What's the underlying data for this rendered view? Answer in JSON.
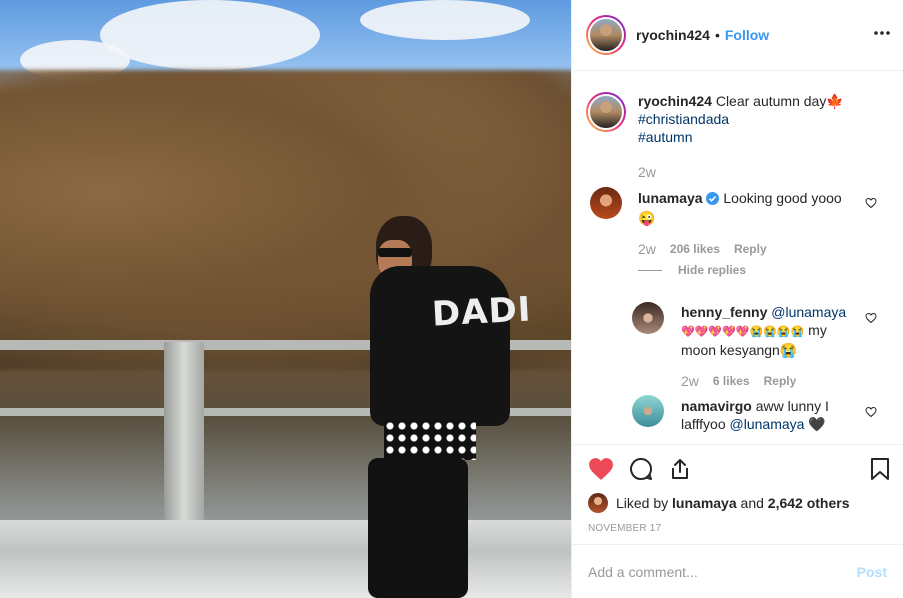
{
  "post": {
    "author": "ryochin424",
    "follow_label": "Follow",
    "separator": "•",
    "more_icon": "more-horizontal-icon"
  },
  "caption": {
    "username": "ryochin424",
    "text": "Clear autumn day",
    "emoji": "🍁",
    "hashtag1": "#christiandada",
    "hashtag2": "#autumn",
    "time": "2w"
  },
  "comments": [
    {
      "username": "lunamaya",
      "verified": true,
      "text": "Looking good yooo",
      "emoji": "😜",
      "time": "2w",
      "likes": "206 likes",
      "reply_label": "Reply",
      "hide_replies_label": "Hide replies",
      "replies": [
        {
          "username": "henny_fenny",
          "mention": "@lunamaya",
          "text_emojis": "💖💖💖💖💖😭😭😭😭",
          "text_after": "my moon kesyangn",
          "text_end_emoji": "😭",
          "time": "2w",
          "likes": "6 likes",
          "reply_label": "Reply"
        },
        {
          "username": "namavirgo",
          "text": "aww lunny I lafffyoo",
          "mention": "@lunamaya",
          "emoji": "🖤"
        }
      ]
    }
  ],
  "liked_by": {
    "prefix": "Liked by",
    "user": "lunamaya",
    "and": "and",
    "others": "2,642 others"
  },
  "date": "NOVEMBER 17",
  "add_comment": {
    "placeholder": "Add a comment...",
    "post_label": "Post"
  },
  "colors": {
    "link": "#3897f0",
    "hashtag": "#003569",
    "like_red": "#ed4956",
    "muted": "#999999",
    "post_disabled": "#b2dffc"
  },
  "photo": {
    "shirt_text": "DADI"
  }
}
